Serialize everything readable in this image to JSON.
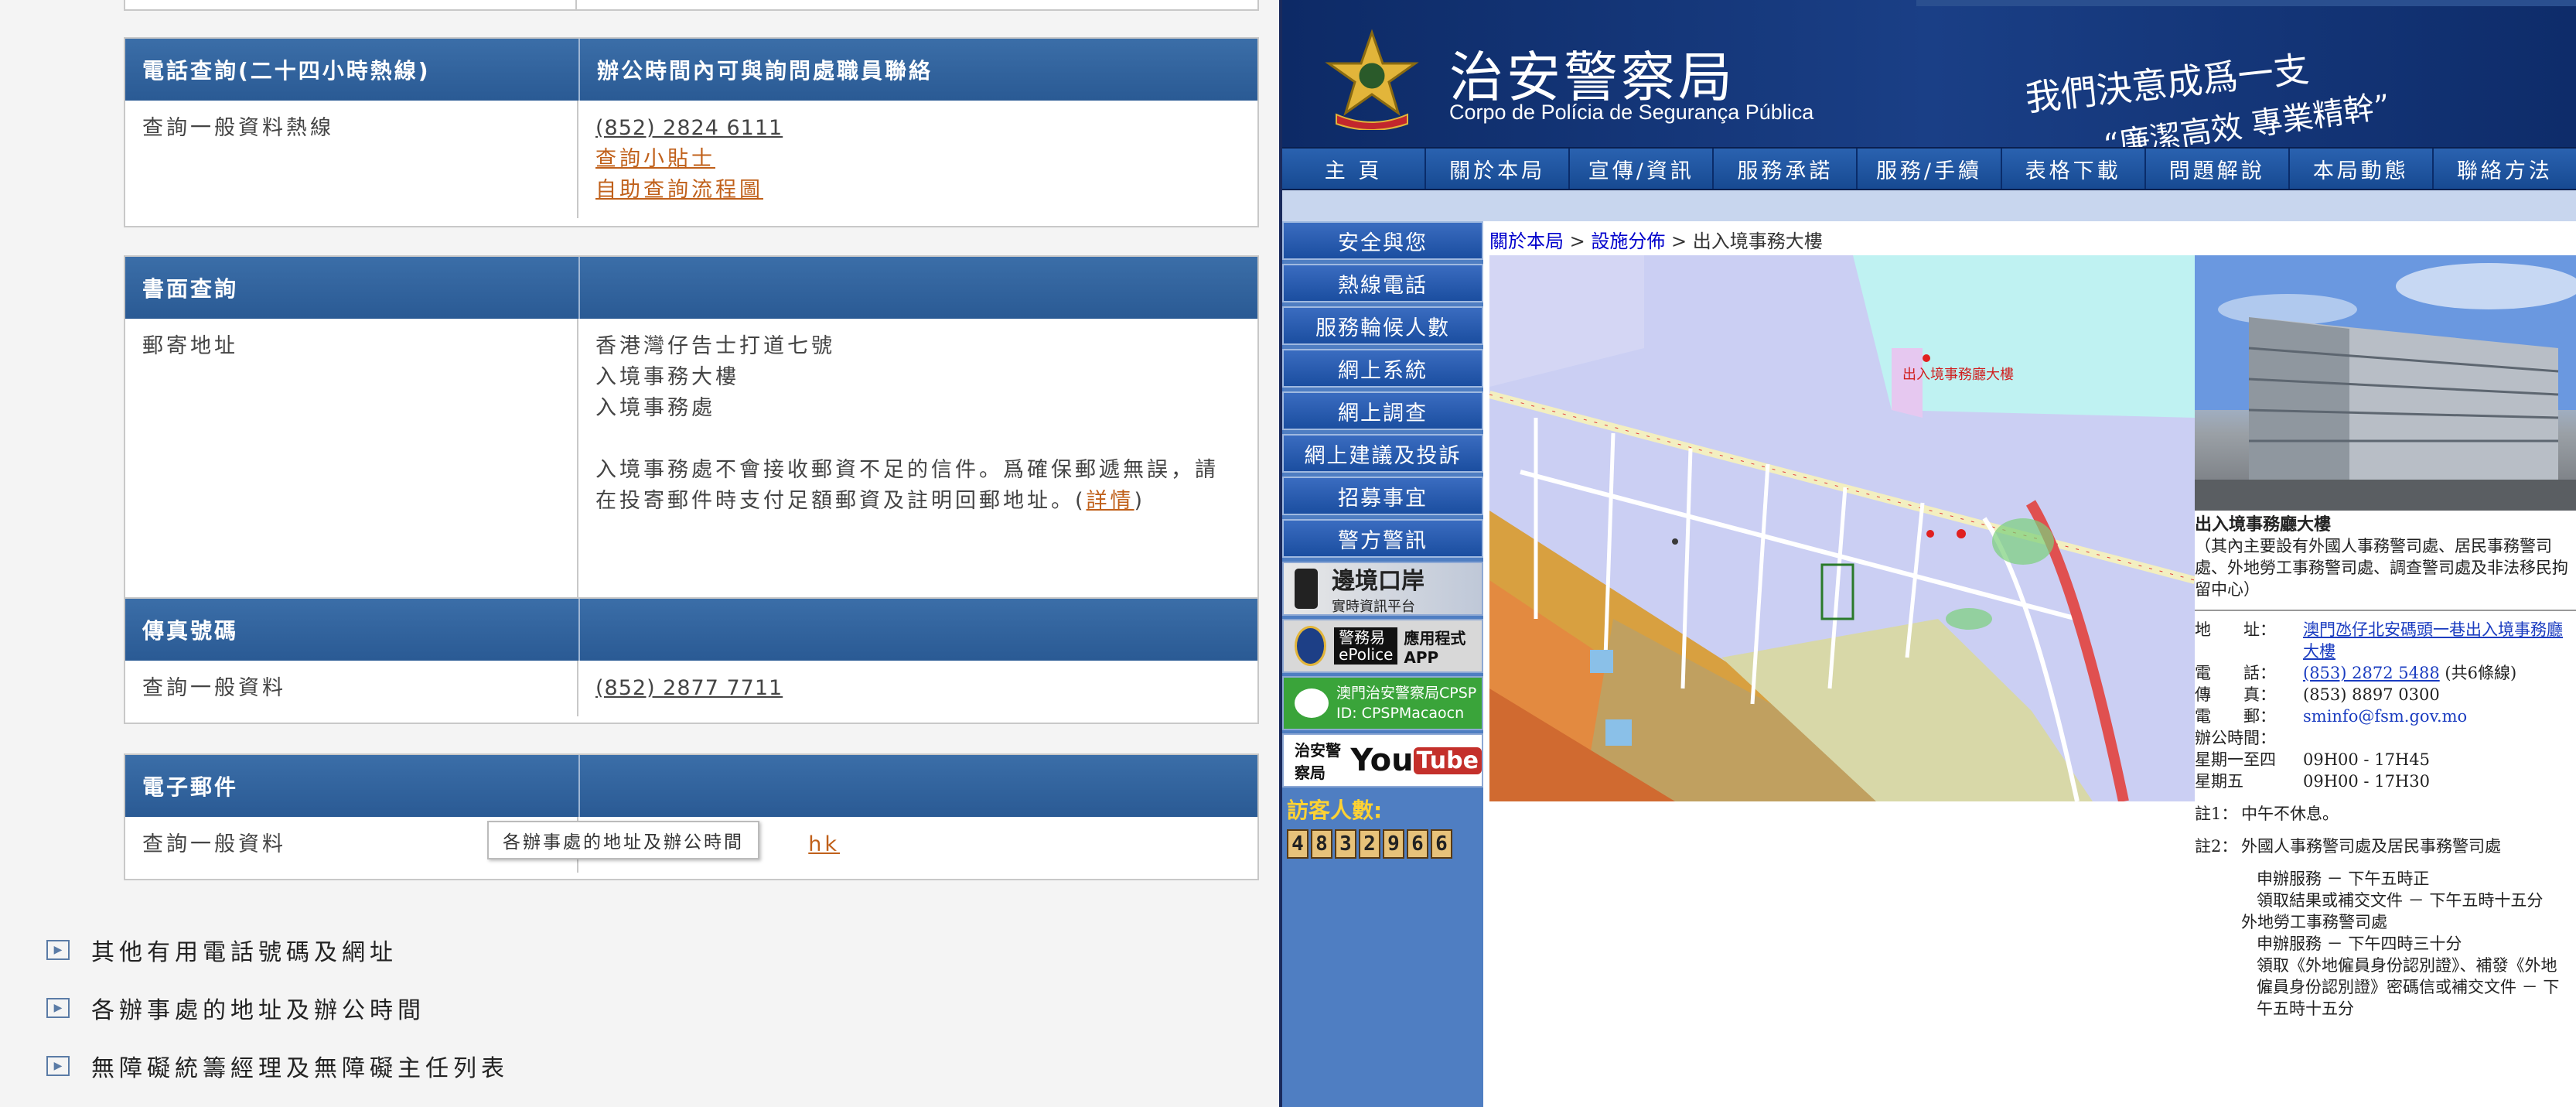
{
  "left": {
    "table_phone": {
      "header_col1": "電話查詢(二十四小時熱線)",
      "header_col2": "辦公時間內可與詢問處職員聯絡",
      "row_label": "查詢一般資料熱線",
      "phone": "(852) 2824 6111",
      "link1": "查詢小貼士",
      "link2": "自助查詢流程圖"
    },
    "table_written": {
      "header_col1": "書面查詢",
      "row_label": "郵寄地址",
      "address_line1": "香港灣仔告士打道七號",
      "address_line2": "入境事務大樓",
      "address_line3": "入境事務處",
      "note": "入境事務處不會接收郵資不足的信件。爲確保郵遞無誤，請在投寄郵件時支付足額郵資及註明回郵地址。(",
      "note_link": "詳情",
      "note_end": ")"
    },
    "table_fax": {
      "header_col1": "傳真號碼",
      "row_label": "查詢一般資料",
      "fax": "(852) 2877 7711"
    },
    "table_email": {
      "header_col1": "電子郵件",
      "row_label": "查詢一般資料",
      "email_tail": "hk"
    },
    "tooltip": "各辦事處的地址及辦公時間",
    "accordion": [
      {
        "label": "其他有用電話號碼及網址"
      },
      {
        "label": "各辦事處的地址及辦公時間"
      },
      {
        "label": "無障礙統籌經理及無障礙主任列表"
      }
    ]
  },
  "right": {
    "title_zh": "治安警察局",
    "title_pt": "Corpo de Polícia de Segurança Pública",
    "slogan1": "我們決意成爲一支",
    "slogan2": "“廉潔高效 專業精幹”",
    "nav": [
      {
        "label": "主 頁"
      },
      {
        "label": "關於本局"
      },
      {
        "label": "宣傳/資訊"
      },
      {
        "label": "服務承諾"
      },
      {
        "label": "服務/手續"
      },
      {
        "label": "表格下載"
      },
      {
        "label": "問題解說"
      },
      {
        "label": "本局動態"
      },
      {
        "label": "聯絡方法"
      }
    ],
    "sidebar": [
      {
        "label": "安全與您"
      },
      {
        "label": "熱線電話"
      },
      {
        "label": "服務輪候人數"
      },
      {
        "label": "網上系統"
      },
      {
        "label": "網上調查"
      },
      {
        "label": "網上建議及投訴"
      },
      {
        "label": "招募事宜"
      },
      {
        "label": "警方警訊"
      }
    ],
    "tiles": {
      "border_title": "邊境口岸",
      "border_sub": "實時資訊平台",
      "epolice_title": "警務易",
      "epolice_sub": "ePolice",
      "epolice_app": "應用程式 APP",
      "wechat_line1": "澳門治安警察局CPSP",
      "wechat_line2": "ID: CPSPMacaocn",
      "youtube_prefix": "治安警察局",
      "youtube_word": "You",
      "youtube_tube": "Tube"
    },
    "visitors_label": "訪客人數:",
    "visitor_digits": [
      "4",
      "8",
      "3",
      "2",
      "9",
      "6",
      "6"
    ],
    "breadcrumb": {
      "item1": "關於本局",
      "item2": "設施分佈",
      "current": "出入境事務大樓",
      "sep": " > "
    },
    "map_label": "出入境事務廳大樓",
    "building": {
      "name": "出入境事務廳大樓",
      "desc": "（其內主要設有外國人事務警司處、居民事務警司處、外地勞工事務警司處、調查警司處及非法移民拘留中心）",
      "address_k": "地　　址：",
      "address_v": "澳門氹仔北安碼頭一巷出入境事務廳大樓",
      "tel_k": "電　　話：",
      "tel_v": "(853) 2872 5488",
      "tel_note": "(共6條線)",
      "fax_k": "傳　　真：",
      "fax_v": "(853) 8897 0300",
      "email_k": "電　　郵：",
      "email_v": "sminfo@fsm.gov.mo",
      "hours_k": "辦公時間：",
      "hours1_k": "星期一至四",
      "hours1_v": "09H00 - 17H45",
      "hours2_k": "星期五",
      "hours2_v": "09H00 - 17H30",
      "note1_k": "註1：",
      "note1_v": "中午不休息。",
      "note2_k": "註2：",
      "note2_v": "外國人事務警司處及居民事務警司處",
      "n2_l1": "申辦服務 － 下午五時正",
      "n2_l2": "領取結果或補交文件 － 下午五時十五分",
      "n2_l3": "外地勞工事務警司處",
      "n2_l4": "申辦服務 － 下午四時三十分",
      "n2_l5": "領取《外地僱員身份認別證》、補發《外地僱員身份認別證》密碼信或補交文件 － 下午五時十五分"
    }
  }
}
